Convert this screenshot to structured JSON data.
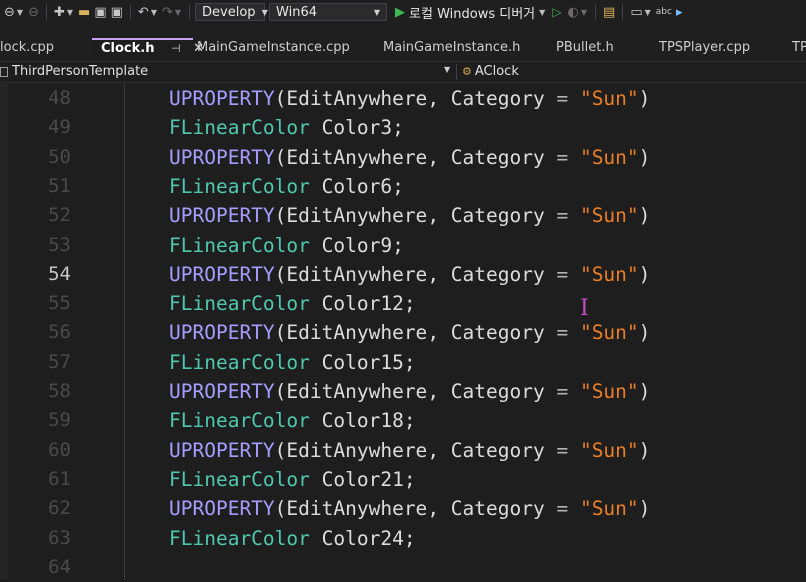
{
  "toolbar": {
    "configuration": "Develop",
    "platform": "Win64",
    "debugger_label": "로컬 Windows 디버거",
    "colors": {
      "play": "#3fb950"
    }
  },
  "tabs": [
    {
      "label": "lock.cpp"
    },
    {
      "label": "Clock.h",
      "active": true,
      "pin": "⊣",
      "close": "✕"
    },
    {
      "label": "MainGameInstance.cpp"
    },
    {
      "label": "MainGameInstance.h"
    },
    {
      "label": "PBullet.h"
    },
    {
      "label": "TPSPlayer.cpp"
    },
    {
      "label": "TP"
    }
  ],
  "navbar": {
    "project": "ThirdPersonTemplate",
    "class": "AClock"
  },
  "editor": {
    "current_line": 54,
    "lines": [
      {
        "num": "48",
        "macro": "UPROPERTY",
        "spec": "EditAnywhere",
        "cat_key": "Category",
        "cat_val": "\"Sun\""
      },
      {
        "num": "49",
        "type": "FLinearColor",
        "name": "Color3"
      },
      {
        "num": "50",
        "macro": "UPROPERTY",
        "spec": "EditAnywhere",
        "cat_key": "Category",
        "cat_val": "\"Sun\""
      },
      {
        "num": "51",
        "type": "FLinearColor",
        "name": "Color6"
      },
      {
        "num": "52",
        "macro": "UPROPERTY",
        "spec": "EditAnywhere",
        "cat_key": "Category",
        "cat_val": "\"Sun\""
      },
      {
        "num": "53",
        "type": "FLinearColor",
        "name": "Color9"
      },
      {
        "num": "54",
        "macro": "UPROPERTY",
        "spec": "EditAnywhere",
        "cat_key": "Category",
        "cat_val": "\"Sun\""
      },
      {
        "num": "55",
        "type": "FLinearColor",
        "name": "Color12"
      },
      {
        "num": "56",
        "macro": "UPROPERTY",
        "spec": "EditAnywhere",
        "cat_key": "Category",
        "cat_val": "\"Sun\""
      },
      {
        "num": "57",
        "type": "FLinearColor",
        "name": "Color15"
      },
      {
        "num": "58",
        "macro": "UPROPERTY",
        "spec": "EditAnywhere",
        "cat_key": "Category",
        "cat_val": "\"Sun\""
      },
      {
        "num": "59",
        "type": "FLinearColor",
        "name": "Color18"
      },
      {
        "num": "60",
        "macro": "UPROPERTY",
        "spec": "EditAnywhere",
        "cat_key": "Category",
        "cat_val": "\"Sun\""
      },
      {
        "num": "61",
        "type": "FLinearColor",
        "name": "Color21"
      },
      {
        "num": "62",
        "macro": "UPROPERTY",
        "spec": "EditAnywhere",
        "cat_key": "Category",
        "cat_val": "\"Sun\""
      },
      {
        "num": "63",
        "type": "FLinearColor",
        "name": "Color24"
      },
      {
        "num": "64"
      }
    ],
    "colors": {
      "macro": "#a79cff",
      "type": "#4ec9b0",
      "string": "#e87e25",
      "identifier": "#dcdcdc",
      "line_number": "#4a4a4a",
      "line_number_current": "#c6c6c6"
    }
  }
}
